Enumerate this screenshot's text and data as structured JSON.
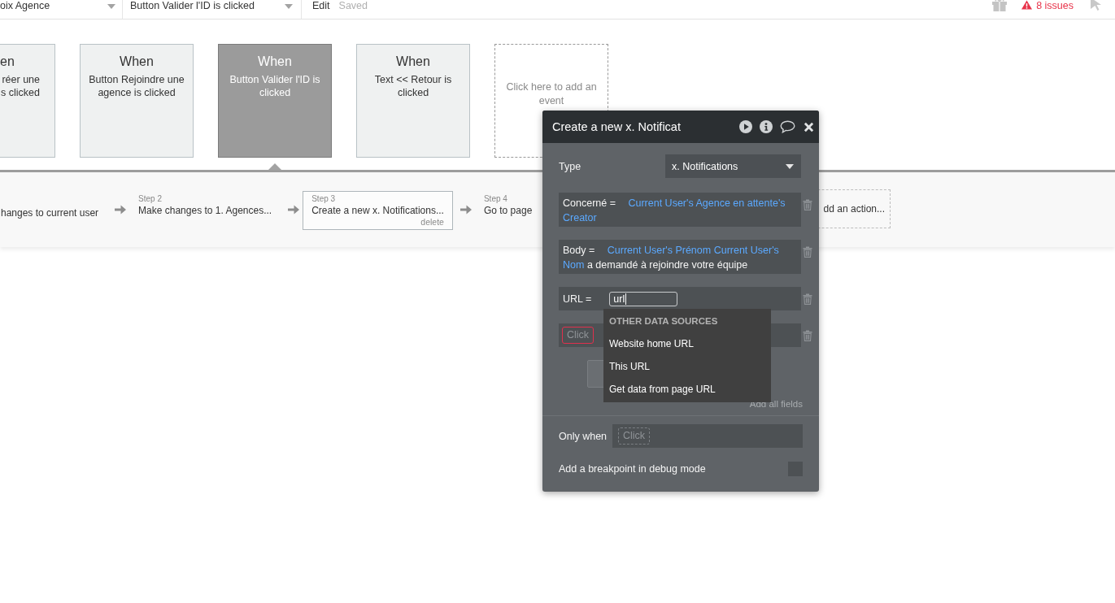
{
  "top_bar": {
    "page_select": "oix Agence",
    "event_select": "Button Valider l'ID is clicked",
    "edit": "Edit",
    "save_status": "Saved",
    "issues": "8 issues"
  },
  "events": [
    {
      "kind": "partial",
      "title": "en",
      "description": "réer une s clicked",
      "selected": false
    },
    {
      "kind": "event",
      "title": "When",
      "description": "Button Rejoindre une agence is clicked",
      "selected": false
    },
    {
      "kind": "event",
      "title": "When",
      "description": "Button Valider l'ID is clicked",
      "selected": true
    },
    {
      "kind": "event",
      "title": "When",
      "description": "Text << Retour is clicked",
      "selected": false
    },
    {
      "kind": "add",
      "description": "Click here to add an event",
      "selected": false
    }
  ],
  "actions": [
    {
      "kind": "partial",
      "text": "hanges to current user",
      "selected": false
    },
    {
      "kind": "step",
      "label": "Step 2",
      "text": "Make changes to 1. Agences...",
      "selected": false
    },
    {
      "kind": "step",
      "label": "Step 3",
      "text": "Create a new x. Notifications...",
      "selected": true,
      "delete": "delete"
    },
    {
      "kind": "step",
      "label": "Step 4",
      "text": "Go to page",
      "selected": false
    },
    {
      "kind": "add",
      "text": "dd an action...",
      "selected": false
    }
  ],
  "action_editor": {
    "title": "Create a new x. Notificat",
    "type_label": "Type",
    "type_value": "x. Notifications",
    "fields": [
      {
        "kind": "expression",
        "label": "Concerné =",
        "parts": [
          {
            "kind": "dynamic",
            "text": "Current User's Agence en attente's Creator"
          }
        ]
      },
      {
        "kind": "expression",
        "label": "Body =",
        "parts": [
          {
            "kind": "dynamic",
            "text": "Current User's Prénom Current User's Nom"
          },
          {
            "kind": "static",
            "text": "a demandé à rejoindre votre équipe"
          }
        ]
      },
      {
        "kind": "input",
        "label": "URL =",
        "value": "url"
      },
      {
        "kind": "picker",
        "picker": "Click",
        "invalid": true
      }
    ],
    "autocomplete": {
      "heading": "OTHER DATA SOURCES",
      "items": [
        {
          "label": "Website home URL",
          "selected": false
        },
        {
          "label": "This URL",
          "selected": false
        },
        {
          "label": "Get data from page URL",
          "selected": false
        }
      ]
    },
    "add_all_fields": "Add all fields",
    "only_when": {
      "label": "Only when",
      "picker": "Click",
      "invalid": false
    },
    "breakpoint": {
      "label": "Add a breakpoint in debug mode",
      "checked": false
    }
  }
}
